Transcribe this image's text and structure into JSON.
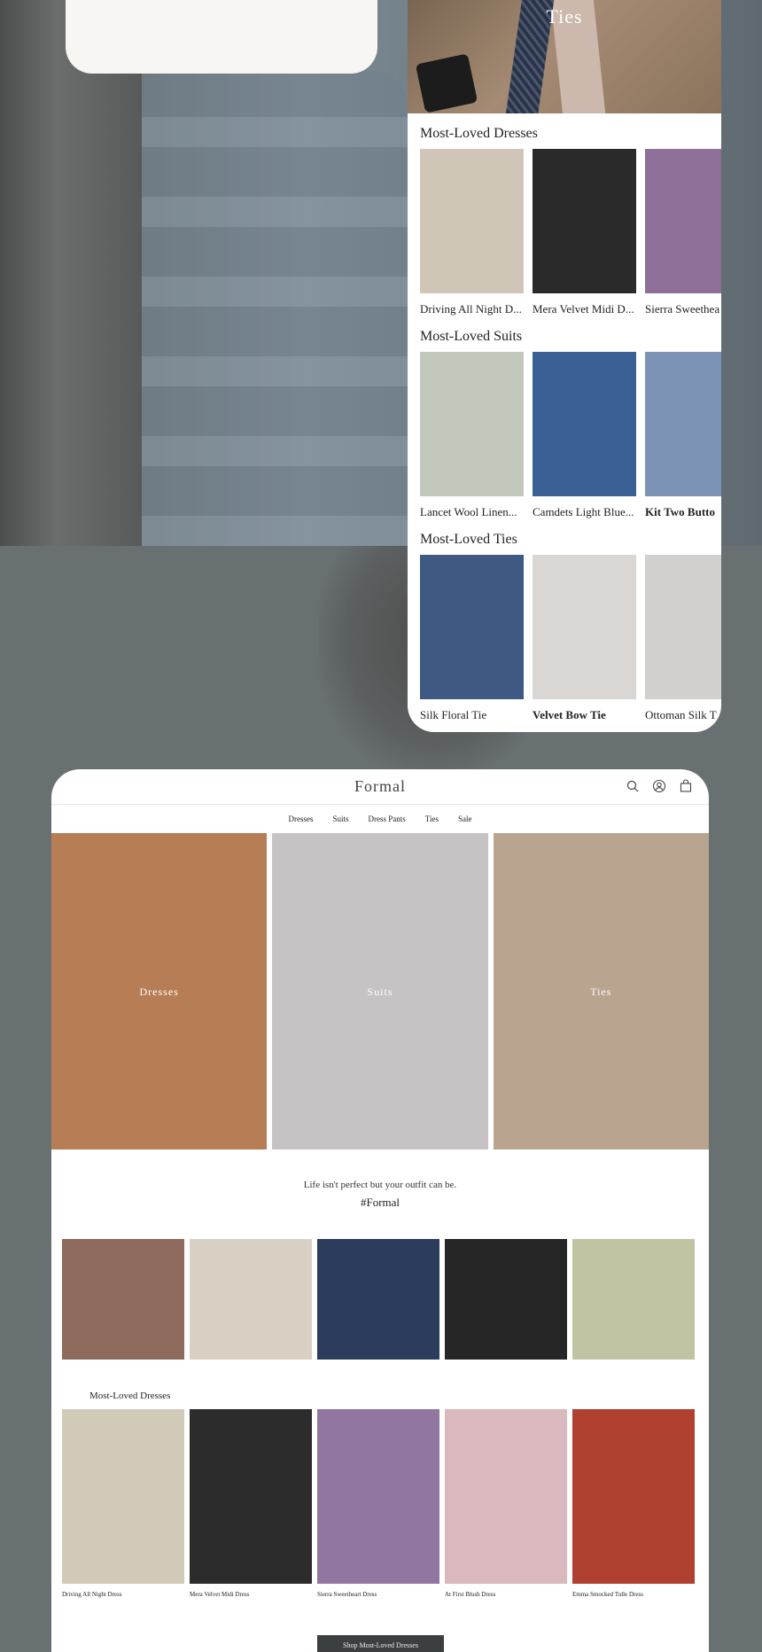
{
  "mobile": {
    "hero_label": "Ties",
    "sections": [
      {
        "title": "Most-Loved Dresses",
        "items": [
          {
            "name": "Driving All Night D...",
            "bold": false,
            "color": "#cfc6b8"
          },
          {
            "name": "Mera Velvet Midi D...",
            "bold": false,
            "color": "#2a2a2a"
          },
          {
            "name": "Sierra Sweethea",
            "bold": false,
            "color": "#8e6f98"
          }
        ]
      },
      {
        "title": "Most-Loved Suits",
        "items": [
          {
            "name": "Lancet Wool Linen...",
            "bold": false,
            "color": "#c3c8bc"
          },
          {
            "name": "Camdets Light Blue...",
            "bold": false,
            "color": "#3a5f94"
          },
          {
            "name": "Kit Two Butto",
            "bold": true,
            "color": "#7c93b5"
          }
        ]
      },
      {
        "title": "Most-Loved Ties",
        "items": [
          {
            "name": "Silk Floral Tie",
            "bold": false,
            "color": "#3e5a82"
          },
          {
            "name": "Velvet Bow Tie",
            "bold": true,
            "color": "#d9d6d3"
          },
          {
            "name": "Ottoman Silk T",
            "bold": false,
            "color": "#d2d0ce"
          }
        ]
      }
    ]
  },
  "desktop": {
    "logo": "Formal",
    "nav": [
      "Dresses",
      "Suits",
      "Dress Pants",
      "Ties",
      "Sale"
    ],
    "categories": [
      {
        "label": "Dresses",
        "color": "#b77e55"
      },
      {
        "label": "Suits",
        "color": "#c7c2c3"
      },
      {
        "label": "Ties",
        "color": "#b9a48f"
      }
    ],
    "tagline": "Life isn't perfect but your outfit can be.",
    "hashtag": "#Formal",
    "gallery_colors": [
      "#8d6a5b",
      "#d9d0c4",
      "#2b3c5d",
      "#262626",
      "#c2c3a2"
    ],
    "products_title": "Most-Loved Dresses",
    "products": [
      {
        "name": "Driving All Night Dress",
        "color": "#d2cab9"
      },
      {
        "name": "Mera Velvet Midi Dress",
        "color": "#2c2c2c"
      },
      {
        "name": "Sierra Sweetheart Dress",
        "color": "#9177a0"
      },
      {
        "name": "At First Blush Dress",
        "color": "#d9b9bd"
      },
      {
        "name": "Emma Smocked Tulle Dress",
        "color": "#b0402f"
      }
    ],
    "cta": "Shop Most-Loved Dresses"
  },
  "icons": {
    "search": "search-icon",
    "account": "account-icon",
    "bag": "bag-icon"
  }
}
